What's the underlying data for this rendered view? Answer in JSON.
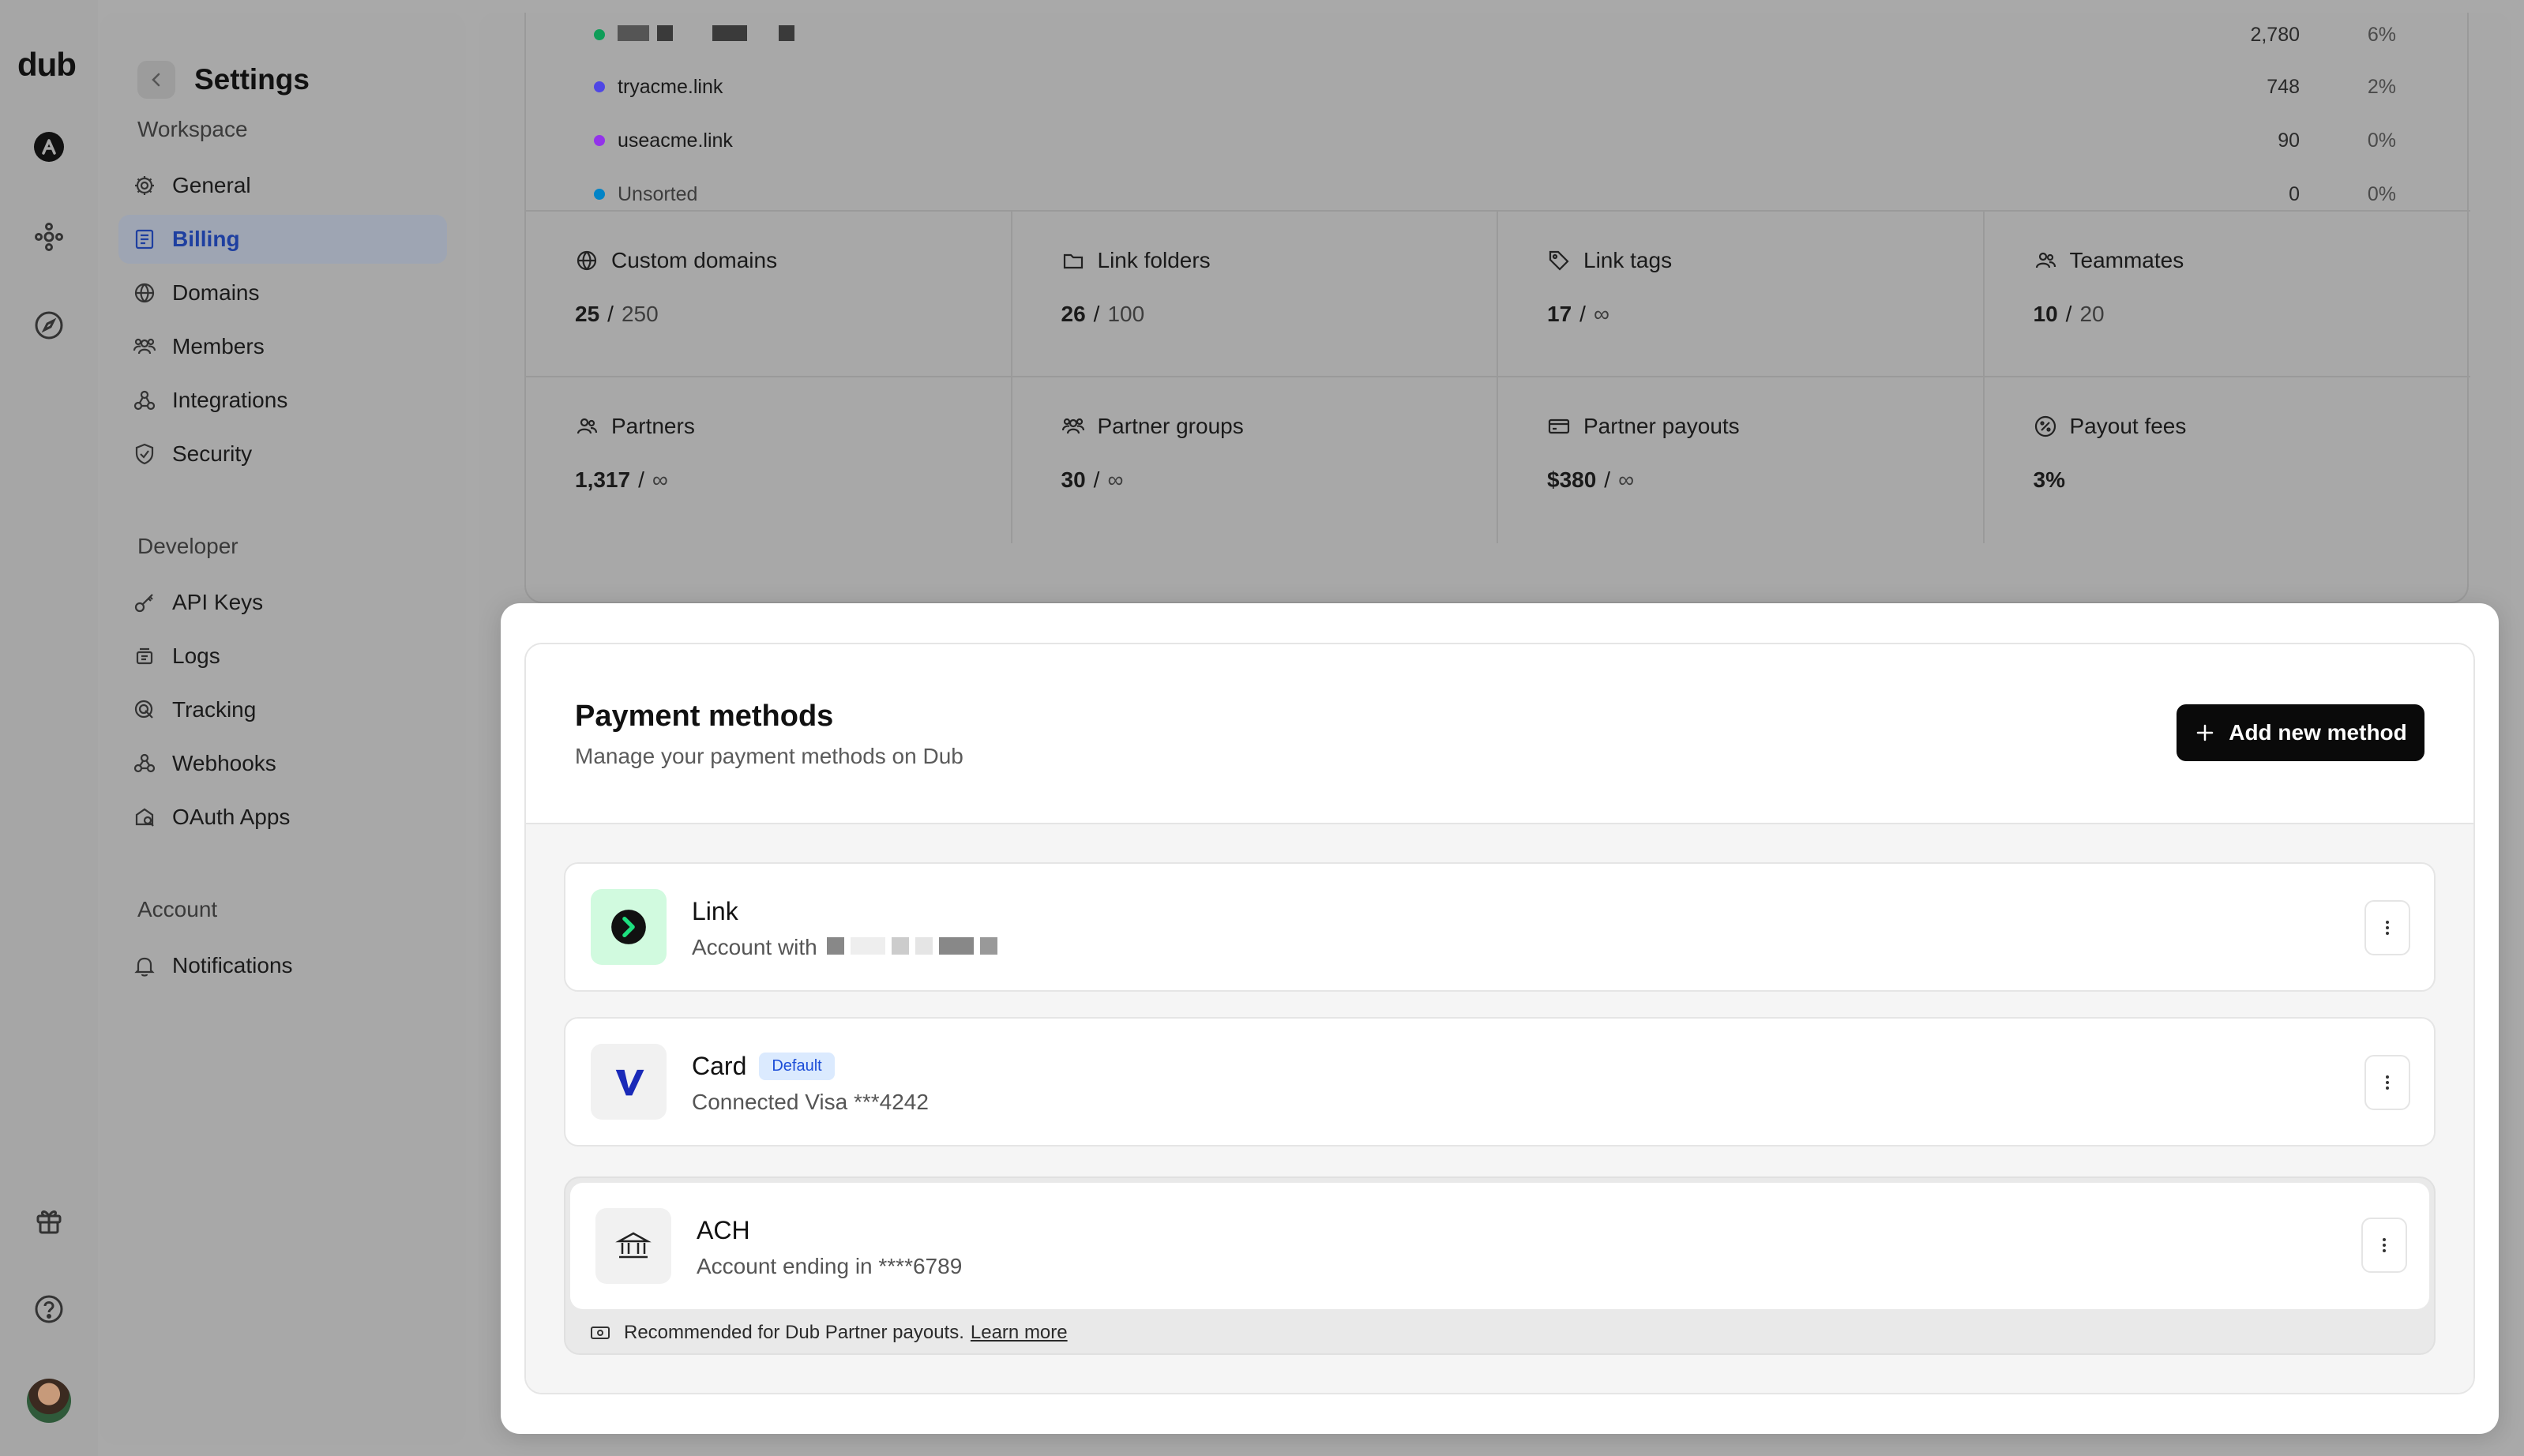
{
  "rail": {
    "logo": "dub",
    "icons": [
      "workspace-icon",
      "network-icon",
      "compass-icon",
      "gift-icon",
      "help-icon"
    ]
  },
  "sidebar": {
    "title": "Settings",
    "sections": {
      "workspace": "Workspace",
      "developer": "Developer",
      "account": "Account"
    },
    "items": [
      {
        "label": "General",
        "icon": "gear-icon"
      },
      {
        "label": "Billing",
        "icon": "receipt-icon",
        "active": true
      },
      {
        "label": "Domains",
        "icon": "globe-icon"
      },
      {
        "label": "Members",
        "icon": "users-icon"
      },
      {
        "label": "Integrations",
        "icon": "integrations-icon"
      },
      {
        "label": "Security",
        "icon": "shield-icon"
      },
      {
        "label": "API Keys",
        "icon": "key-icon"
      },
      {
        "label": "Logs",
        "icon": "logs-icon"
      },
      {
        "label": "Tracking",
        "icon": "tracking-icon"
      },
      {
        "label": "Webhooks",
        "icon": "webhook-icon"
      },
      {
        "label": "OAuth Apps",
        "icon": "oauth-icon"
      },
      {
        "label": "Notifications",
        "icon": "bell-icon"
      }
    ]
  },
  "domains": [
    {
      "name": "",
      "value": "2,780",
      "pct": "6%",
      "color": "#0f9d58"
    },
    {
      "name": "tryacme.link",
      "value": "748",
      "pct": "2%",
      "color": "#4f46e5"
    },
    {
      "name": "useacme.link",
      "value": "90",
      "pct": "0%",
      "color": "#9333ea"
    },
    {
      "name": "Unsorted",
      "value": "0",
      "pct": "0%",
      "color": "#0284c7"
    }
  ],
  "stats": [
    {
      "label": "Custom domains",
      "used": "25",
      "limit": "250",
      "icon": "globe-icon"
    },
    {
      "label": "Link folders",
      "used": "26",
      "limit": "100",
      "icon": "folder-icon"
    },
    {
      "label": "Link tags",
      "used": "17",
      "limit": "∞",
      "icon": "tag-icon"
    },
    {
      "label": "Teammates",
      "used": "10",
      "limit": "20",
      "icon": "users-icon"
    },
    {
      "label": "Partners",
      "used": "1,317",
      "limit": "∞",
      "icon": "partners-icon"
    },
    {
      "label": "Partner groups",
      "used": "30",
      "limit": "∞",
      "icon": "groups-icon"
    },
    {
      "label": "Partner payouts",
      "used": "$380",
      "limit": "∞",
      "icon": "card-icon"
    },
    {
      "label": "Payout fees",
      "used": "3%",
      "limit": "",
      "icon": "percent-icon"
    }
  ],
  "payment": {
    "title": "Payment methods",
    "subtitle": "Manage your payment methods on Dub",
    "add_label": "Add new method",
    "methods": [
      {
        "name": "Link",
        "desc": "Account with",
        "badge": ""
      },
      {
        "name": "Card",
        "desc": "Connected Visa ***4242",
        "badge": "Default"
      },
      {
        "name": "ACH",
        "desc": "Account ending in ****6789",
        "badge": ""
      }
    ],
    "ach_note": "Recommended for Dub Partner payouts.",
    "learn_more": "Learn more"
  }
}
